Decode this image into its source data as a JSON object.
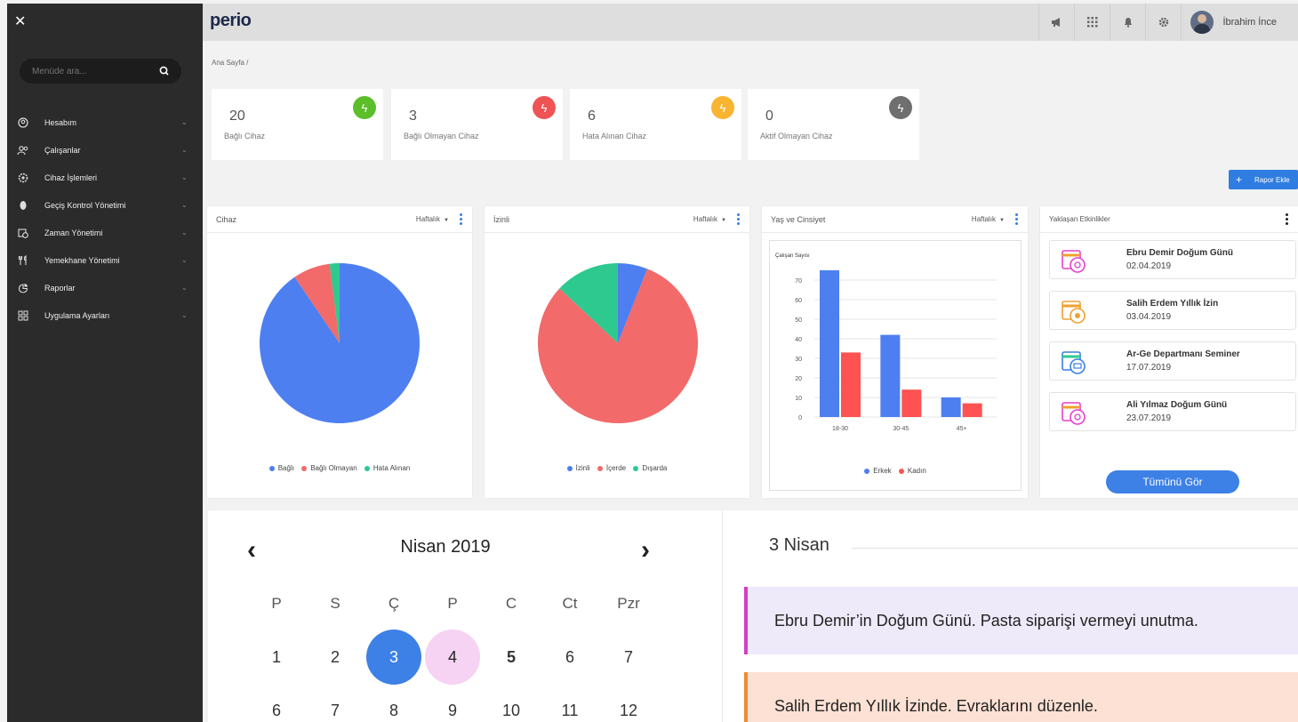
{
  "sidebar": {
    "search_placeholder": "Menüde ara...",
    "items": [
      {
        "label": "Hesabım",
        "icon": "user-circle-icon"
      },
      {
        "label": "Çalışanlar",
        "icon": "users-icon"
      },
      {
        "label": "Cihaz İşlemleri",
        "icon": "device-gear-icon"
      },
      {
        "label": "Geçiş Kontrol Yönetimi",
        "icon": "fingerprint-icon"
      },
      {
        "label": "Zaman Yönetimi",
        "icon": "clock-calendar-icon"
      },
      {
        "label": "Yemekhane Yönetimi",
        "icon": "fork-knife-icon"
      },
      {
        "label": "Raporlar",
        "icon": "chart-pie-icon"
      },
      {
        "label": "Uygulama Ayarları",
        "icon": "grid-icon"
      }
    ]
  },
  "topbar": {
    "logo": "perio",
    "user_name": "İbrahim İnce"
  },
  "breadcrumb": "Ana Sayfa  /",
  "stats": [
    {
      "value": "20",
      "label": "Bağlı Cihaz",
      "color": "#5cbf2a"
    },
    {
      "value": "3",
      "label": "Bağlı Olmayan Cihaz",
      "color": "#ef5353"
    },
    {
      "value": "6",
      "label": "Hata Alınan Cihaz",
      "color": "#f9b531"
    },
    {
      "value": "0",
      "label": "Aktif Olmayan Cihaz",
      "color": "#6f6f6f"
    }
  ],
  "rapor_button": "Rapor Ekle",
  "panels": {
    "cihaz": {
      "title": "Cihaz",
      "filter": "Haftalık"
    },
    "izinli": {
      "title": "İzinli",
      "filter": "Haftalık"
    },
    "yas": {
      "title": "Yaş ve Cinsiyet",
      "filter": "Haftalık"
    },
    "events": {
      "title": "Yaklaşan Etkinlikler",
      "button": "Tümünü Gör"
    }
  },
  "chart_data": [
    {
      "type": "pie",
      "title": "Cihaz",
      "categories": [
        "Bağlı",
        "Bağlı Olmayan",
        "Hata Alınan"
      ],
      "values": [
        90.5,
        7.5,
        2
      ],
      "colors": [
        "#4d7ff0",
        "#f26a6a",
        "#2ec98f"
      ]
    },
    {
      "type": "pie",
      "title": "İzinli",
      "categories": [
        "İzinli",
        "İçerde",
        "Dışarda"
      ],
      "values": [
        6,
        81,
        13
      ],
      "colors": [
        "#4d7ff0",
        "#f26a6a",
        "#2ec98f"
      ]
    },
    {
      "type": "bar",
      "title": "Yaş ve Cinsiyet",
      "ylabel": "Çalışan Sayısı",
      "categories": [
        "18-30",
        "30-45",
        "45+"
      ],
      "series": [
        {
          "name": "Erkek",
          "values": [
            75,
            42,
            10
          ],
          "color": "#4d7ff0"
        },
        {
          "name": "Kadın",
          "values": [
            33,
            14,
            7
          ],
          "color": "#ff5252"
        }
      ],
      "ylim": [
        0,
        80
      ],
      "yticks": [
        0,
        10,
        20,
        30,
        40,
        50,
        60,
        70
      ],
      "grid": true,
      "legend": "bottom"
    }
  ],
  "events": [
    {
      "title": "Ebru Demir Doğum Günü",
      "date": "02.04.2019",
      "icon": "calendar-cake-icon"
    },
    {
      "title": "Salih Erdem Yıllık İzin",
      "date": "03.04.2019",
      "icon": "calendar-sun-icon"
    },
    {
      "title": "Ar-Ge Departmanı Seminer",
      "date": "17.07.2019",
      "icon": "calendar-board-icon"
    },
    {
      "title": "Ali Yılmaz Doğum Günü",
      "date": "23.07.2019",
      "icon": "calendar-cake-icon"
    }
  ],
  "calendar": {
    "month": "Nisan  2019",
    "weekdays": [
      "P",
      "S",
      "Ç",
      "P",
      "C",
      "Ct",
      "Pzr"
    ],
    "week1": [
      "1",
      "2",
      "3",
      "4",
      "5",
      "6",
      "7"
    ],
    "week2": [
      "8",
      "9",
      "10",
      "11",
      "12"
    ],
    "week2_first": "6",
    "week2_second": "7",
    "selected": "3",
    "marked": "4"
  },
  "day": {
    "title": "3 Nisan",
    "notes": [
      "Ebru Demir’in Doğum Günü. Pasta siparişi vermeyi unutma.",
      "Salih Erdem Yıllık İzinde. Evraklarını düzenle."
    ]
  }
}
